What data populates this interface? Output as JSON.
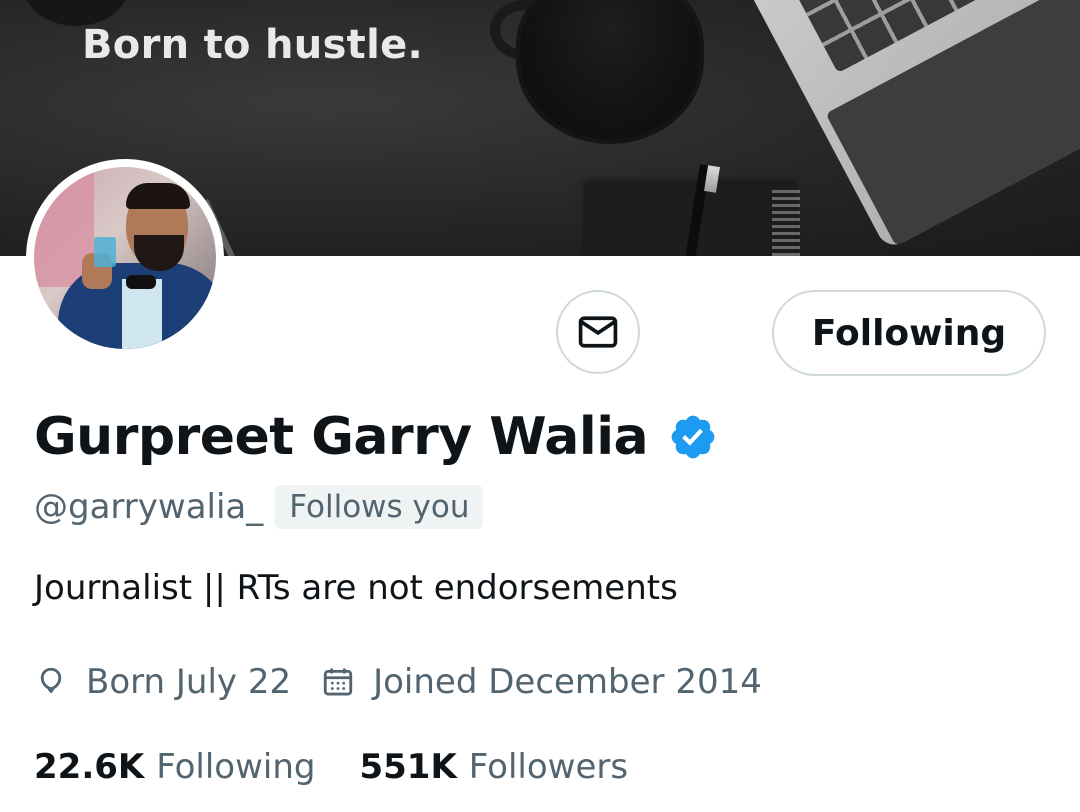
{
  "banner": {
    "tagline": "Born to hustle."
  },
  "actions": {
    "message_icon": "envelope-icon",
    "follow_label": "Following"
  },
  "profile": {
    "display_name": "Gurpreet Garry Walia",
    "verified": true,
    "verified_color": "#1d9bf0",
    "handle": "@garrywalia_",
    "follows_you_label": "Follows you",
    "bio": "Journalist || RTs are not endorsements",
    "birthday": "Born July 22",
    "joined": "Joined December 2014"
  },
  "stats": {
    "following_count": "22.6K",
    "following_label": "Following",
    "followers_count": "551K",
    "followers_label": "Followers"
  },
  "colors": {
    "text_primary": "#0f1419",
    "text_secondary": "#536471",
    "border": "#cfd9de",
    "badge_bg": "#eff3f4"
  }
}
